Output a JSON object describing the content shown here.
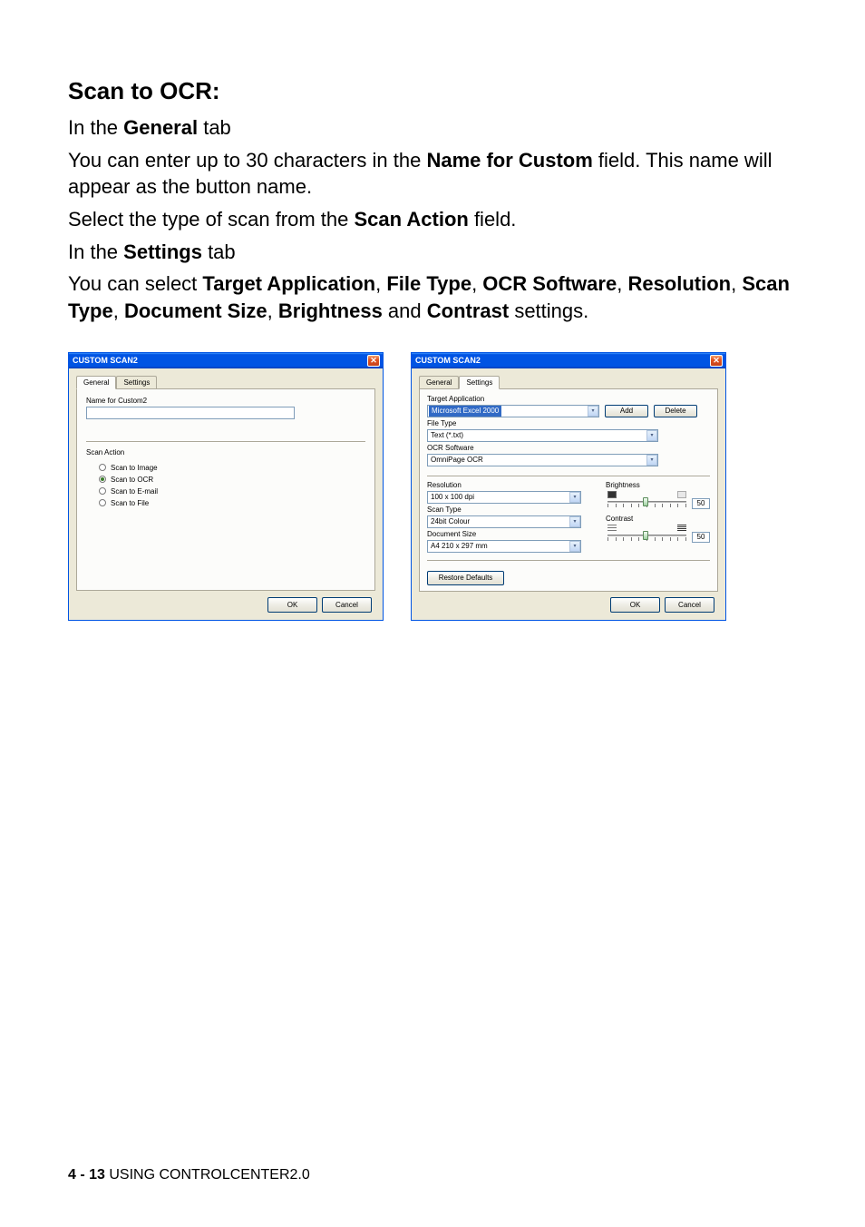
{
  "doc": {
    "heading": "Scan to OCR:",
    "p1_pre": "In the ",
    "p1_bold": "General",
    "p1_post": " tab",
    "p2_pre": "You can enter up to 30 characters in the ",
    "p2_bold": "Name for Custom",
    "p2_post": " field. This name will appear as the button name.",
    "p3_pre": "Select the type of scan from the ",
    "p3_bold": "Scan Action",
    "p3_post": " field.",
    "p4_pre": "In the ",
    "p4_bold": "Settings",
    "p4_post": " tab",
    "p5_pre": "You can select ",
    "p5_b1": "Target Application",
    "p5_s1": ", ",
    "p5_b2": "File Type",
    "p5_s2": ", ",
    "p5_b3": "OCR Software",
    "p5_s3": ", ",
    "p5_b4": "Resolution",
    "p5_s4": ", ",
    "p5_b5": "Scan Type",
    "p5_s5": ", ",
    "p5_b6": "Document Size",
    "p5_s6": ", ",
    "p5_b7": "Brightness",
    "p5_s7": " and ",
    "p5_b8": "Contrast",
    "p5_post": " settings."
  },
  "dialog1": {
    "title": "CUSTOM SCAN2",
    "tab_general": "General",
    "tab_settings": "Settings",
    "name_label": "Name for Custom2",
    "name_value": "",
    "scan_action_label": "Scan Action",
    "radios": [
      {
        "label": "Scan to Image",
        "checked": false
      },
      {
        "label": "Scan to OCR",
        "checked": true
      },
      {
        "label": "Scan to E-mail",
        "checked": false
      },
      {
        "label": "Scan to File",
        "checked": false
      }
    ],
    "ok": "OK",
    "cancel": "Cancel"
  },
  "dialog2": {
    "title": "CUSTOM SCAN2",
    "tab_general": "General",
    "tab_settings": "Settings",
    "target_app_label": "Target Application",
    "target_app_value": "Microsoft Excel 2000",
    "add_btn": "Add",
    "delete_btn": "Delete",
    "file_type_label": "File Type",
    "file_type_value": "Text (*.txt)",
    "ocr_label": "OCR Software",
    "ocr_value": "OmniPage OCR",
    "resolution_label": "Resolution",
    "resolution_value": "100 x 100 dpi",
    "scan_type_label": "Scan Type",
    "scan_type_value": "24bit Colour",
    "doc_size_label": "Document Size",
    "doc_size_value": "A4 210 x 297 mm",
    "brightness_label": "Brightness",
    "brightness_value": "50",
    "contrast_label": "Contrast",
    "contrast_value": "50",
    "restore": "Restore Defaults",
    "ok": "OK",
    "cancel": "Cancel"
  },
  "footer": {
    "page": "4 - 13",
    "section": "   USING CONTROLCENTER2.0"
  }
}
